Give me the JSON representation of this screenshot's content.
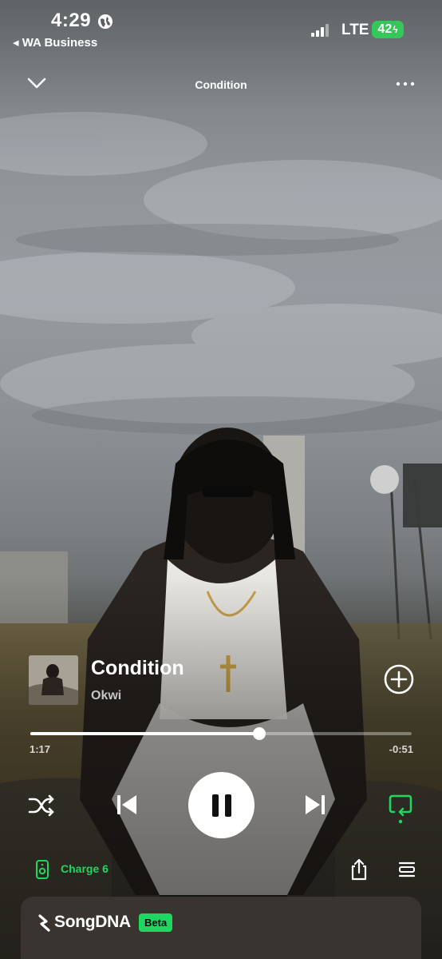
{
  "status_bar": {
    "time": "4:29",
    "back_app": "◂ WA Business",
    "network": "LTE",
    "battery": "42",
    "battery_color": "#34c759"
  },
  "nav": {
    "title": "Condition",
    "collapse_icon": "chevron-down-icon",
    "more_icon": "more-dots-icon"
  },
  "track": {
    "title": "Condition",
    "artist": "Okwi"
  },
  "progress": {
    "elapsed": "1:17",
    "remaining": "-0:51",
    "fraction": 0.6
  },
  "controls": {
    "shuffle_icon": "shuffle-icon",
    "previous_icon": "skip-previous-icon",
    "play_state": "playing",
    "next_icon": "skip-next-icon",
    "repeat_icon": "repeat-icon",
    "accent_color": "#1ed760"
  },
  "device": {
    "name": "Charge 6",
    "icon": "speaker-icon"
  },
  "song_dna": {
    "name": "SongDNA",
    "badge": "Beta"
  }
}
